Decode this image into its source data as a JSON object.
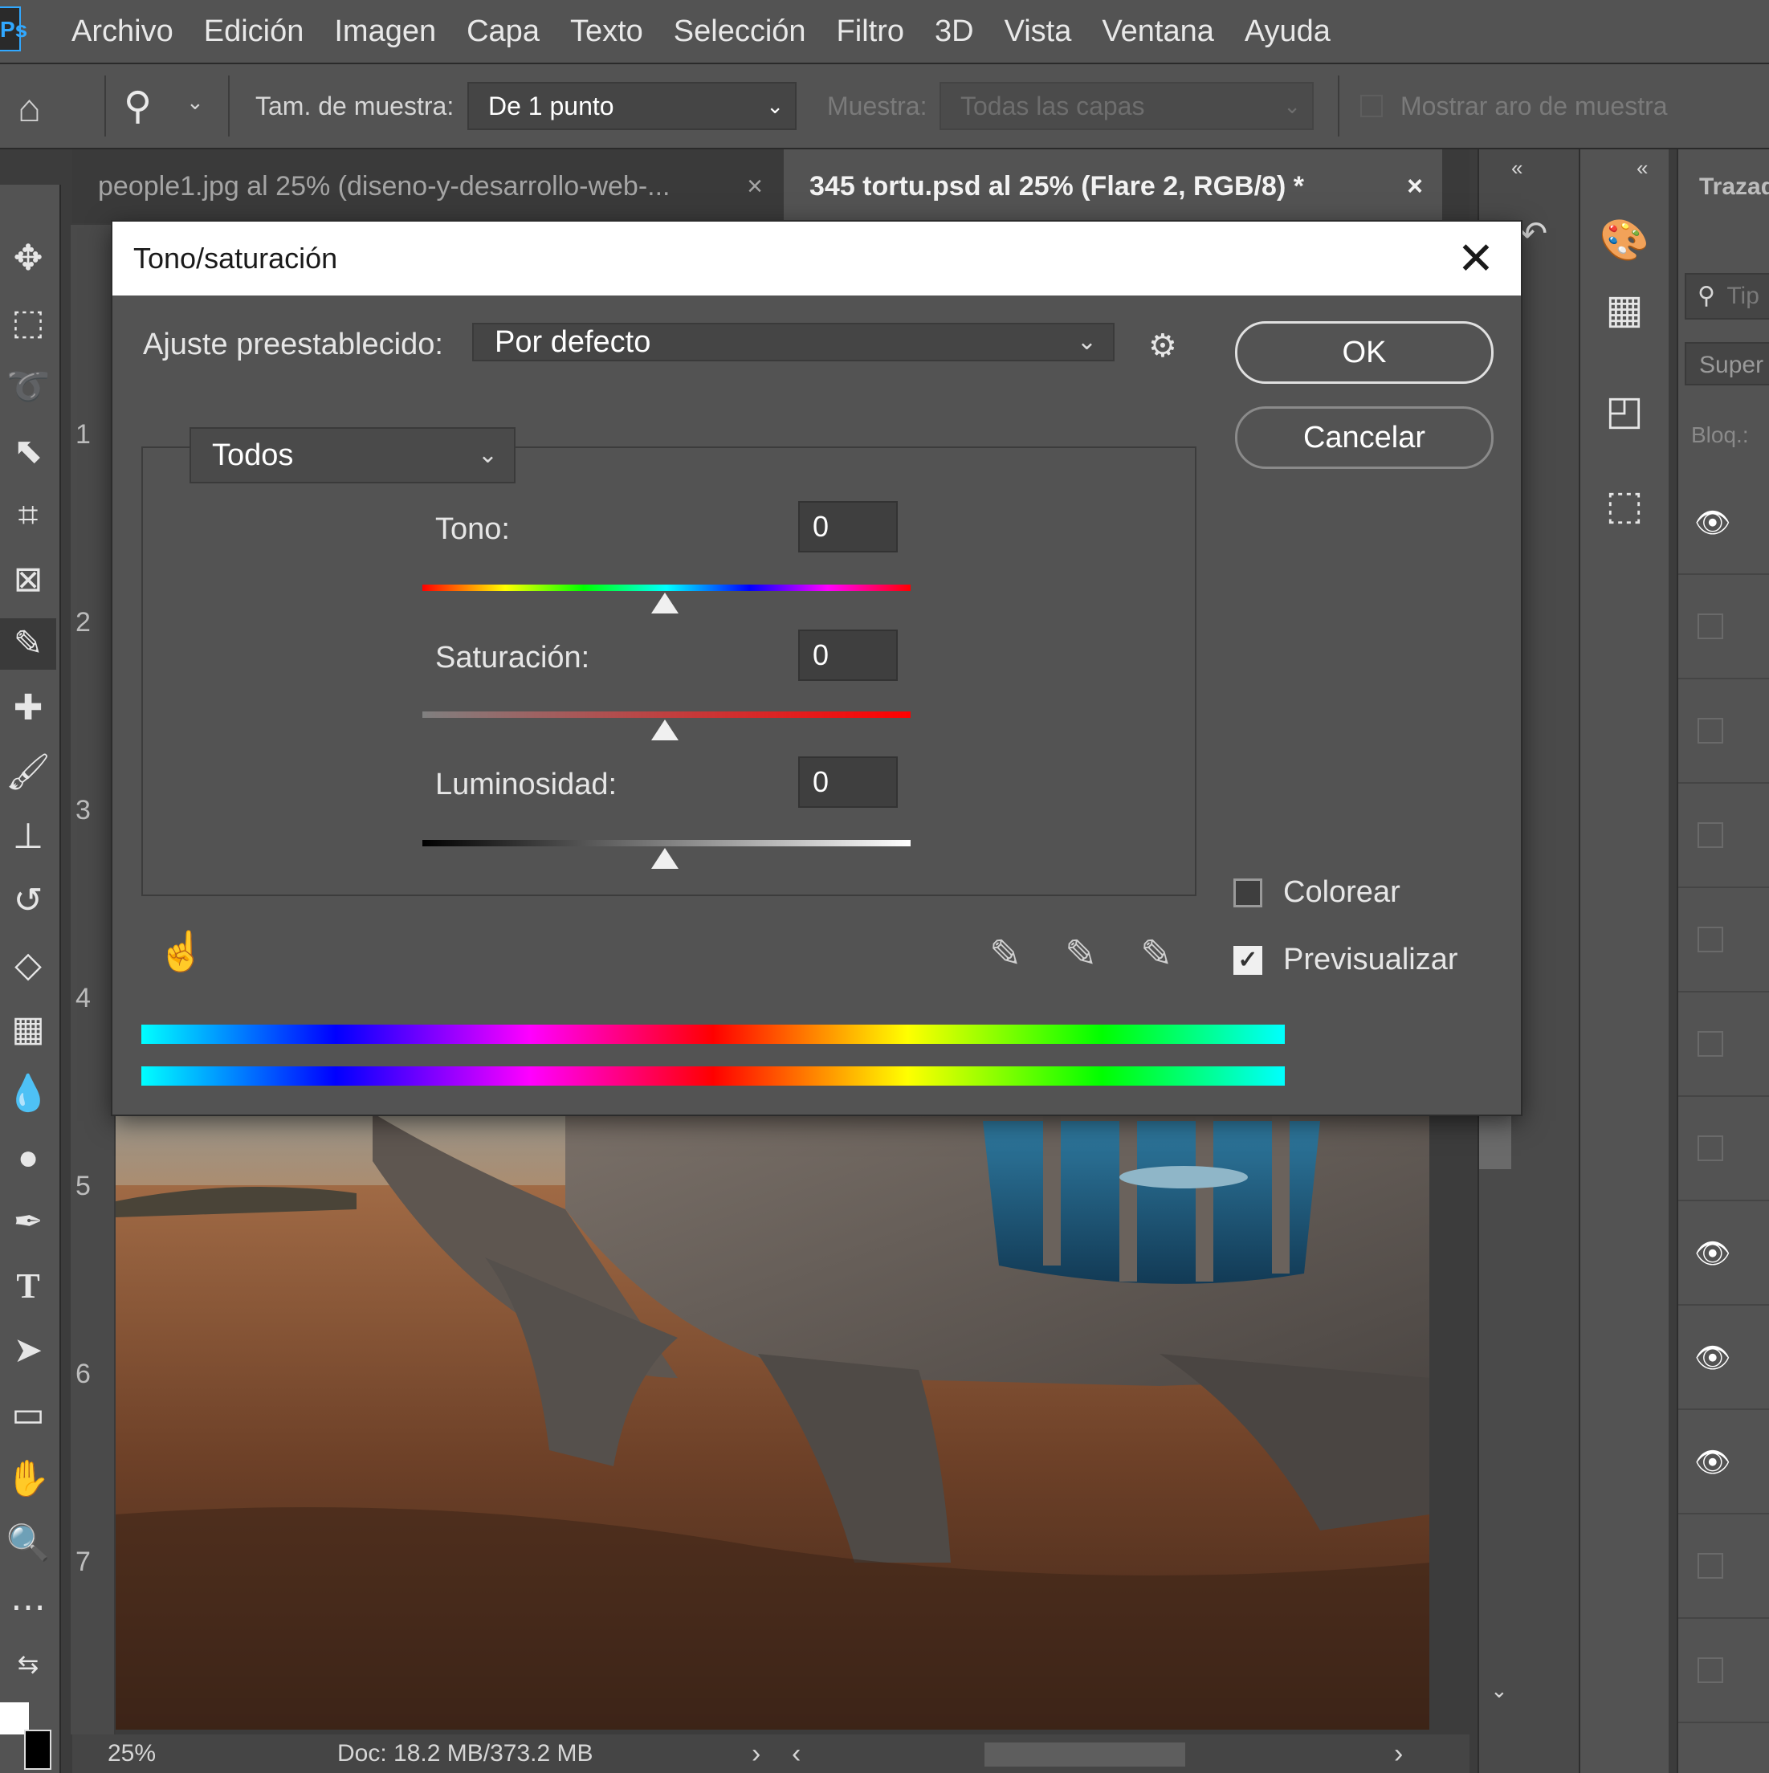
{
  "app": {
    "logo": "Ps"
  },
  "menu": [
    "Archivo",
    "Edición",
    "Imagen",
    "Capa",
    "Texto",
    "Selección",
    "Filtro",
    "3D",
    "Vista",
    "Ventana",
    "Ayuda"
  ],
  "options": {
    "sample_size_label": "Tam. de muestra:",
    "sample_size_value": "De 1 punto",
    "sample_label": "Muestra:",
    "sample_value": "Todas las capas",
    "show_ring_label": "Mostrar aro de muestra"
  },
  "tabs": [
    {
      "label": "people1.jpg al 25% (diseno-y-desarrollo-web-...",
      "active": false
    },
    {
      "label": "345 tortu.psd al 25% (Flare 2, RGB/8) *",
      "active": true
    }
  ],
  "ruler": [
    "1",
    "2",
    "3",
    "4",
    "5",
    "6",
    "7"
  ],
  "status": {
    "zoom": "25%",
    "doc": "Doc: 18.2 MB/373.2 MB"
  },
  "right_panel": {
    "title": "Trazad",
    "search": "Tip",
    "blend": "Super",
    "lock": "Bloq.:"
  },
  "dialog": {
    "title": "Tono/saturación",
    "preset_label": "Ajuste preestablecido:",
    "preset_value": "Por defecto",
    "ok": "OK",
    "cancel": "Cancelar",
    "channel": "Todos",
    "hue_label": "Tono:",
    "hue_value": "0",
    "sat_label": "Saturación:",
    "sat_value": "0",
    "light_label": "Luminosidad:",
    "light_value": "0",
    "colorize_label": "Colorear",
    "colorize_checked": false,
    "preview_label": "Previsualizar",
    "preview_checked": true
  },
  "colors": {
    "accent": "#31a8ff",
    "panel": "#535353",
    "dialog_bg": "#535353"
  }
}
